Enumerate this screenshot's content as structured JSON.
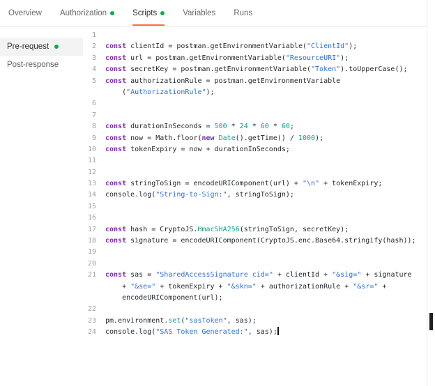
{
  "tabs": [
    {
      "label": "Overview",
      "dot": false,
      "active": false
    },
    {
      "label": "Authorization",
      "dot": true,
      "active": false
    },
    {
      "label": "Scripts",
      "dot": true,
      "active": true
    },
    {
      "label": "Variables",
      "dot": false,
      "active": false
    },
    {
      "label": "Runs",
      "dot": false,
      "active": false
    }
  ],
  "sidebar": {
    "items": [
      {
        "label": "Pre-request",
        "dot": true,
        "active": true
      },
      {
        "label": "Post-response",
        "dot": false,
        "active": false
      }
    ]
  },
  "editor": {
    "rows": [
      {
        "num": "1",
        "tokens": []
      },
      {
        "num": "2",
        "tokens": [
          {
            "t": "k",
            "v": "const"
          },
          {
            "t": "p",
            "v": " clientId = postman.getEnvironmentVariable("
          },
          {
            "t": "s",
            "v": "\"ClientId\""
          },
          {
            "t": "p",
            "v": ");"
          }
        ]
      },
      {
        "num": "3",
        "tokens": [
          {
            "t": "k",
            "v": "const"
          },
          {
            "t": "p",
            "v": " url = postman.getEnvironmentVariable("
          },
          {
            "t": "s",
            "v": "\"ResourceURI\""
          },
          {
            "t": "p",
            "v": ");"
          }
        ]
      },
      {
        "num": "4",
        "tokens": [
          {
            "t": "k",
            "v": "const"
          },
          {
            "t": "p",
            "v": " secretKey = postman.getEnvironmentVariable("
          },
          {
            "t": "s",
            "v": "\"Token\""
          },
          {
            "t": "p",
            "v": ").toUpperCase();"
          }
        ]
      },
      {
        "num": "5",
        "tokens": [
          {
            "t": "k",
            "v": "const"
          },
          {
            "t": "p",
            "v": " authorizationRule = postman.getEnvironmentVariable"
          }
        ]
      },
      {
        "num": "",
        "tokens": [
          {
            "t": "p",
            "v": "    ("
          },
          {
            "t": "s",
            "v": "\"AuthorizationRule\""
          },
          {
            "t": "p",
            "v": ");"
          }
        ]
      },
      {
        "num": "6",
        "tokens": []
      },
      {
        "num": "7",
        "tokens": []
      },
      {
        "num": "8",
        "tokens": [
          {
            "t": "k",
            "v": "const"
          },
          {
            "t": "p",
            "v": " durationInSeconds = "
          },
          {
            "t": "n",
            "v": "500"
          },
          {
            "t": "p",
            "v": " * "
          },
          {
            "t": "n",
            "v": "24"
          },
          {
            "t": "p",
            "v": " * "
          },
          {
            "t": "n",
            "v": "60"
          },
          {
            "t": "p",
            "v": " * "
          },
          {
            "t": "n",
            "v": "60"
          },
          {
            "t": "p",
            "v": ";"
          }
        ]
      },
      {
        "num": "9",
        "tokens": [
          {
            "t": "k",
            "v": "const"
          },
          {
            "t": "p",
            "v": " now = Math.floor("
          },
          {
            "t": "k",
            "v": "new"
          },
          {
            "t": "p",
            "v": " "
          },
          {
            "t": "f",
            "v": "Date"
          },
          {
            "t": "p",
            "v": "().getTime() / "
          },
          {
            "t": "n",
            "v": "1000"
          },
          {
            "t": "p",
            "v": ");"
          }
        ]
      },
      {
        "num": "10",
        "tokens": [
          {
            "t": "k",
            "v": "const"
          },
          {
            "t": "p",
            "v": " tokenExpiry = now + durationInSeconds;"
          }
        ]
      },
      {
        "num": "11",
        "tokens": []
      },
      {
        "num": "12",
        "tokens": []
      },
      {
        "num": "13",
        "tokens": [
          {
            "t": "k",
            "v": "const"
          },
          {
            "t": "p",
            "v": " stringToSign = encodeURIComponent(url) + "
          },
          {
            "t": "s",
            "v": "\"\\n\""
          },
          {
            "t": "p",
            "v": " + tokenExpiry;"
          }
        ]
      },
      {
        "num": "14",
        "tokens": [
          {
            "t": "p",
            "v": "console.log("
          },
          {
            "t": "s",
            "v": "\"String-to-Sign:\""
          },
          {
            "t": "p",
            "v": ", stringToSign);"
          }
        ]
      },
      {
        "num": "15",
        "tokens": []
      },
      {
        "num": "16",
        "tokens": []
      },
      {
        "num": "17",
        "tokens": [
          {
            "t": "k",
            "v": "const"
          },
          {
            "t": "p",
            "v": " hash = CryptoJS."
          },
          {
            "t": "f",
            "v": "HmacSHA256"
          },
          {
            "t": "p",
            "v": "(stringToSign, secretKey);"
          }
        ]
      },
      {
        "num": "18",
        "tokens": [
          {
            "t": "k",
            "v": "const"
          },
          {
            "t": "p",
            "v": " signature = encodeURIComponent(CryptoJS.enc.Base64.stringify(hash));"
          }
        ]
      },
      {
        "num": "19",
        "tokens": []
      },
      {
        "num": "20",
        "tokens": []
      },
      {
        "num": "21",
        "tokens": [
          {
            "t": "k",
            "v": "const"
          },
          {
            "t": "p",
            "v": " sas = "
          },
          {
            "t": "s",
            "v": "\"SharedAccessSignature cid=\""
          },
          {
            "t": "p",
            "v": " + clientId + "
          },
          {
            "t": "s",
            "v": "\"&sig=\""
          },
          {
            "t": "p",
            "v": " + signature"
          }
        ]
      },
      {
        "num": "",
        "tokens": [
          {
            "t": "p",
            "v": "    + "
          },
          {
            "t": "s",
            "v": "\"&se=\""
          },
          {
            "t": "p",
            "v": " + tokenExpiry + "
          },
          {
            "t": "s",
            "v": "\"&skn=\""
          },
          {
            "t": "p",
            "v": " + authorizationRule + "
          },
          {
            "t": "s",
            "v": "\"&sr=\""
          },
          {
            "t": "p",
            "v": " +"
          }
        ]
      },
      {
        "num": "",
        "tokens": [
          {
            "t": "p",
            "v": "    encodeURIComponent(url);"
          }
        ]
      },
      {
        "num": "22",
        "tokens": []
      },
      {
        "num": "23",
        "tokens": [
          {
            "t": "p",
            "v": "pm.environment."
          },
          {
            "t": "f",
            "v": "set"
          },
          {
            "t": "p",
            "v": "("
          },
          {
            "t": "s",
            "v": "\"sasToken\""
          },
          {
            "t": "p",
            "v": ", sas);"
          }
        ]
      },
      {
        "num": "24",
        "tokens": [
          {
            "t": "p",
            "v": "console.log("
          },
          {
            "t": "s",
            "v": "\"SAS Token Generated:\""
          },
          {
            "t": "p",
            "v": ", sas);"
          }
        ],
        "cursor": true
      }
    ]
  },
  "colors": {
    "accent": "#ff6c37",
    "dot-green": "#0caf49",
    "kw": "#7d2ea8",
    "str": "#2f6fd0",
    "num": "#0e9f8a",
    "fn": "#0e9f8a",
    "code-text": "#24292e",
    "line-num": "#9aa0a6"
  }
}
